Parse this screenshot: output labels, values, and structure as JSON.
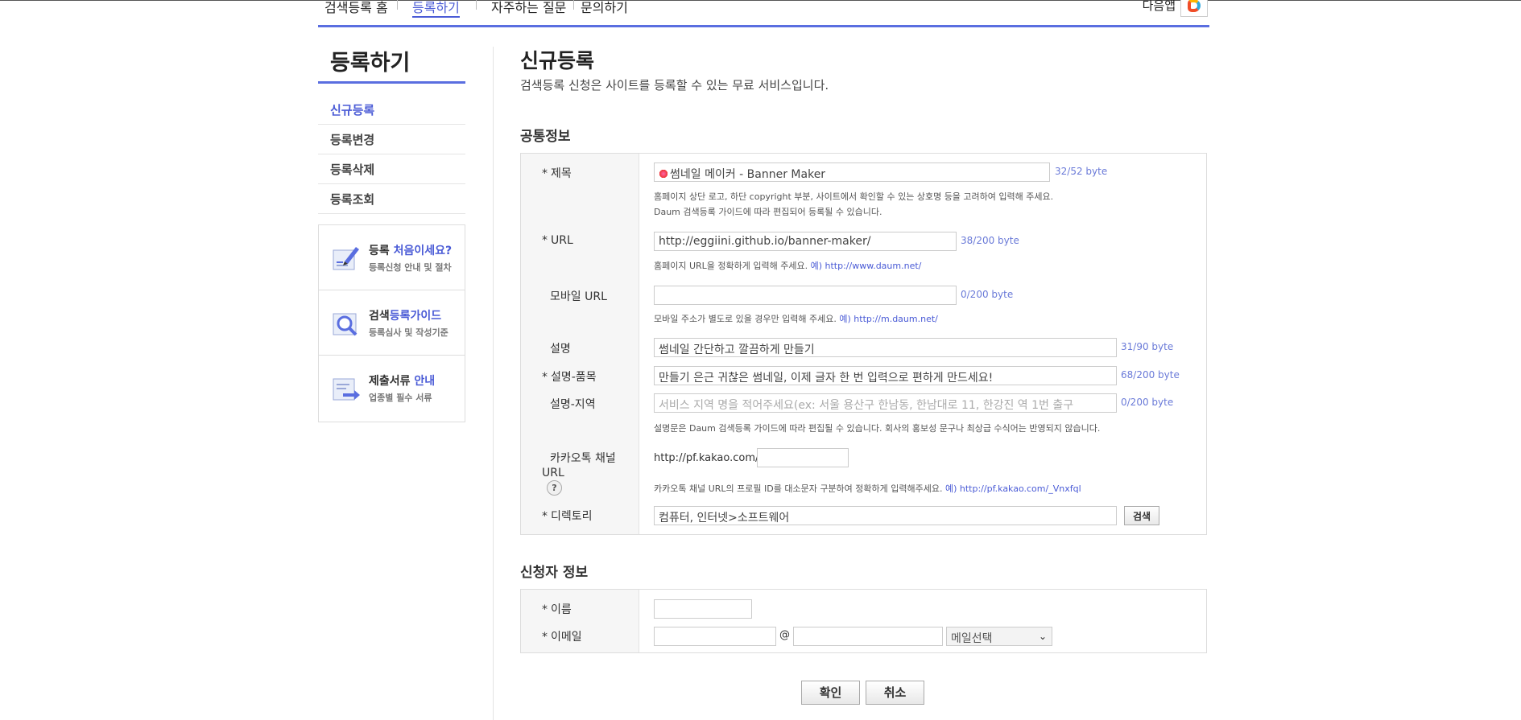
{
  "topnav": {
    "items": [
      {
        "label": "검색등록 홈",
        "active": false
      },
      {
        "label": "등록하기",
        "active": true
      },
      {
        "label": "자주하는 질문",
        "active": false
      },
      {
        "label": "문의하기",
        "active": false
      }
    ],
    "daum_label": "다음앱"
  },
  "sidebar": {
    "title": "등록하기",
    "menu": [
      {
        "label": "신규등록",
        "active": true
      },
      {
        "label": "등록변경",
        "active": false
      },
      {
        "label": "등록삭제",
        "active": false
      },
      {
        "label": "등록조회",
        "active": false
      }
    ],
    "boxes": [
      {
        "title_a": "등록 ",
        "title_b": "처음이세요?",
        "title_c": "",
        "sub": "등록신청 안내 및 절차",
        "icon": "pencil-doc-icon"
      },
      {
        "title_a": "검색",
        "title_b": "등록가이드",
        "title_c": "",
        "sub": "등록심사 및 작성기준",
        "icon": "magnifier-doc-icon"
      },
      {
        "title_a": "제출서류 ",
        "title_b": "안내",
        "title_c": "",
        "sub": "업종별 필수 서류",
        "icon": "submit-doc-icon"
      }
    ]
  },
  "main": {
    "title": "신규등록",
    "desc": "검색등록 신청은 사이트를 등록할 수 있는 무료 서비스입니다."
  },
  "common": {
    "section_title": "공통정보",
    "title_label": "제목",
    "title_value": "썸네일 메이커 - Banner Maker",
    "title_byte_a": "32",
    "title_byte_b": "/52 byte",
    "title_help1": "홈페이지 상단 로고, 하단 copyright 부분, 사이트에서 확인할 수 있는 상호명 등을 고려하여 입력해 주세요.",
    "title_help2": "Daum 검색등록 가이드에 따라 편집되어 등록될 수 있습니다.",
    "url_label": "URL",
    "url_value": "http://eggiini.github.io/banner-maker/",
    "url_byte_a": "38",
    "url_byte_b": "/200 byte",
    "url_help": "홈페이지 URL을 정확하게 입력해 주세요. ",
    "url_help_ex": "예) http://www.daum.net/",
    "mobile_label": "모바일 URL",
    "mobile_value": "",
    "mobile_byte_a": "0",
    "mobile_byte_b": "/200 byte",
    "mobile_help": "모바일 주소가 별도로 있을 경우만 입력해 주세요. ",
    "mobile_help_ex": "예) http://m.daum.net/",
    "desc_label": "설명",
    "desc_value": "썸네일 간단하고 깔끔하게 만들기",
    "desc_byte_a": "31",
    "desc_byte_b": "/90 byte",
    "desc_item_label": "설명-품목",
    "desc_item_value": "만들기 은근 귀찮은 썸네일, 이제 글자 한 번 입력으로 편하게 만드세요!",
    "desc_item_byte_a": "68",
    "desc_item_byte_b": "/200 byte",
    "desc_region_label": "설명-지역",
    "desc_region_placeholder": "서비스 지역 명을 적어주세요(ex: 서울  용산구 한남동, 한남대로 11, 한강진 역 1번 출구",
    "desc_region_byte_a": "0",
    "desc_region_byte_b": "/200 byte",
    "desc_help": "설명문은 Daum 검색등록 가이드에 따라 편집될 수 있습니다. 회사의 홍보성 문구나 최상급 수식어는 반영되지 않습니다.",
    "kakao_label_1": "카카오톡 채널",
    "kakao_label_2": "URL",
    "kakao_q": "?",
    "kakao_prefix": "http://pf.kakao.com/",
    "kakao_value": "",
    "kakao_help": "카카오톡 채널 URL의 프로필 ID를 대소문자 구분하여 정확하게 입력해주세요. ",
    "kakao_help_ex": "예) http://pf.kakao.com/_Vnxfql",
    "dir_label": "디렉토리",
    "dir_value": "컴퓨터, 인터넷>소프트웨어",
    "dir_button": "검색",
    "req_mark": "*"
  },
  "applicant": {
    "section_title": "신청자 정보",
    "name_label": "이름",
    "name_value": "",
    "email_label": "이메일",
    "email_user": "",
    "at": "@",
    "email_domain": "",
    "email_select": "메일선택",
    "chevron": "⌄"
  },
  "buttons": {
    "confirm": "확인",
    "cancel": "취소"
  },
  "colors": {
    "accent": "#5a6ee0",
    "link": "#4a5bd6"
  }
}
